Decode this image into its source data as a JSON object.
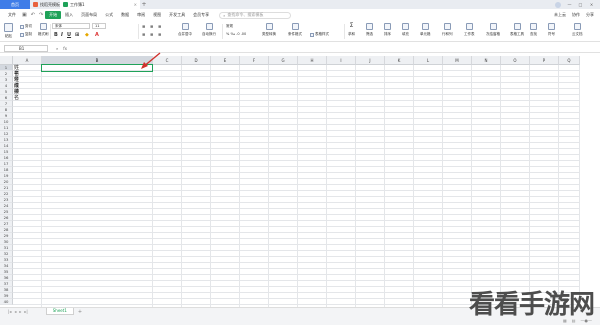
{
  "tabs": [
    {
      "label": "首页"
    },
    {
      "label": "找稻壳模板"
    },
    {
      "label": "工作簿1"
    }
  ],
  "menu": {
    "items": [
      "文件",
      "开始",
      "插入",
      "页面布局",
      "公式",
      "数据",
      "审阅",
      "视图",
      "开发工具",
      "会员专享"
    ],
    "search_placeholder": "查找命令、搜索模板",
    "right": [
      "未上云",
      "协作",
      "分享"
    ]
  },
  "ribbon": {
    "paste": "粘贴",
    "cut": "剪切",
    "copy": "复制",
    "format_painter": "格式刷",
    "font_name": "宋体",
    "font_size": "11",
    "merge_center": "合并居中",
    "wrap": "自动换行",
    "general": "常规",
    "convert": "类型转换",
    "cond_format": "条件格式",
    "table_style": "表格样式",
    "sum": "求和",
    "filter": "筛选",
    "sort": "排序",
    "fill": "填充",
    "cell": "单元格",
    "row_col": "行和列",
    "worksheet": "工作表",
    "freeze": "冻结窗格",
    "table_tools": "表格工具",
    "find": "查找",
    "symbol": "符号",
    "cloud": "云文档"
  },
  "formula_bar": {
    "cell_ref": "B1",
    "fx": "fx",
    "value": ""
  },
  "columns": [
    "A",
    "B",
    "C",
    "D",
    "E",
    "F",
    "G",
    "H",
    "I",
    "J",
    "K",
    "L",
    "M",
    "N",
    "O",
    "P",
    "Q"
  ],
  "selected_column": "B",
  "rows": [
    "1",
    "2",
    "3",
    "4",
    "5",
    "6",
    "7",
    "8",
    "9",
    "10",
    "11",
    "12",
    "13",
    "14",
    "15",
    "16",
    "17",
    "18",
    "19",
    "20",
    "21",
    "22",
    "23",
    "24",
    "25",
    "26",
    "27",
    "28",
    "29",
    "30",
    "31",
    "32",
    "33",
    "34",
    "35",
    "36",
    "37",
    "38",
    "39",
    "40",
    "41"
  ],
  "cells_col_a": [
    "姓名",
    "学号",
    "班级",
    "成绩",
    "排名"
  ],
  "sheet_tab": "Sheet1",
  "watermark": "看看手游网",
  "accent_color": "#1fa259"
}
